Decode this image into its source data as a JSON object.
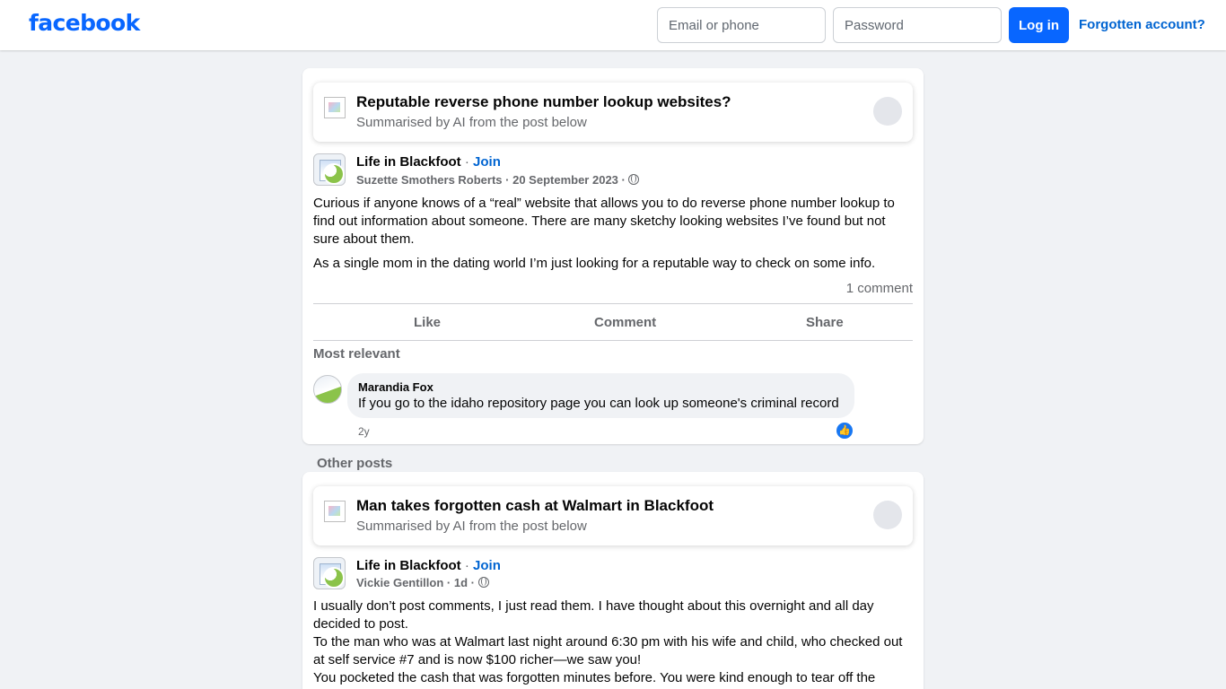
{
  "header": {
    "logo": "facebook",
    "email_placeholder": "Email or phone",
    "password_placeholder": "Password",
    "login_label": "Log in",
    "forgot_label": "Forgotten account?"
  },
  "colors": {
    "brand": "#0866ff",
    "link": "#0064d1",
    "page_bg": "#f0f2f5",
    "secondary_text": "#65676b"
  },
  "post": {
    "summary_title": "Reputable reverse phone number lookup websites?",
    "summary_sub": "Summarised by AI from the post below",
    "group": "Life in Blackfoot",
    "separator": " · ",
    "join": "Join",
    "author": "Suzette Smothers Roberts",
    "date": "20 September 2023",
    "privacy_icon": "globe-icon",
    "body_paragraph_1": "Curious if anyone knows of a “real” website that allows you to do reverse phone number lookup to find out information about someone. There are many sketchy looking websites I’ve found but not sure about them.",
    "body_paragraph_2": "As a single mom in the dating world I’m just looking for a reputable way to check on some info.",
    "comment_count": "1 comment",
    "actions": {
      "like": "Like",
      "comment": "Comment",
      "share": "Share"
    },
    "comments_sort": "Most relevant",
    "comment": {
      "author": "Marandia Fox",
      "text": "If you go to the idaho repository page you can look up someone's criminal record",
      "age": "2y",
      "reaction_icon": "thumbs-up-icon"
    }
  },
  "other_posts_heading": "Other posts",
  "other_post": {
    "summary_title": "Man takes forgotten cash at Walmart in Blackfoot",
    "summary_sub": "Summarised by AI from the post below",
    "group": "Life in Blackfoot",
    "join": "Join",
    "author": "Vickie Gentillon",
    "age": "1d",
    "body_line_1": "I usually don’t post comments, I just read them.  I have thought about this overnight and all day decided to post.",
    "body_line_2": "To the man who was at Walmart last night around 6:30 pm with his wife and child, who checked out at self service #7  and is now $100 richer—we saw you!",
    "body_line_3": "You pocketed the cash that was  forgotten minutes before.  You were kind enough to tear off the"
  }
}
